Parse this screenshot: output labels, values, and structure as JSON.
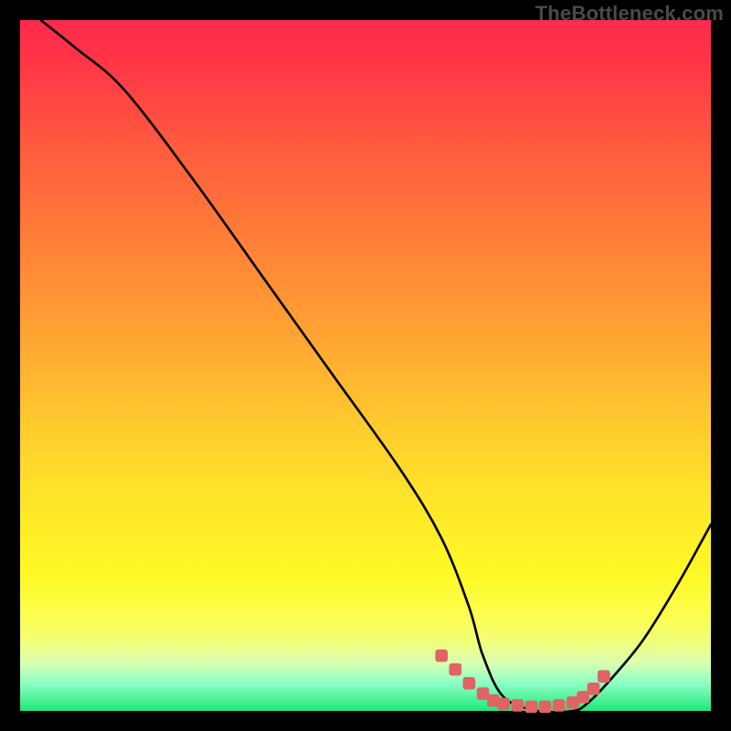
{
  "watermark": "TheBottleneck.com",
  "chart_data": {
    "type": "line",
    "title": "",
    "xlabel": "",
    "ylabel": "",
    "xlim": [
      0,
      100
    ],
    "ylim": [
      0,
      100
    ],
    "grid": false,
    "legend": false,
    "series": [
      {
        "name": "bottleneck-curve",
        "x": [
          3,
          8,
          15,
          25,
          35,
          45,
          55,
          61,
          65,
          67,
          70,
          75,
          80,
          82,
          85,
          90,
          95,
          100
        ],
        "y": [
          100,
          96,
          90,
          77,
          63,
          49,
          35,
          25,
          15,
          8,
          2,
          0,
          0,
          1,
          4,
          10,
          18,
          27
        ],
        "color": "#000000",
        "stroke_width": 2
      },
      {
        "name": "optimal-dots",
        "type": "scatter",
        "x": [
          61,
          63,
          65,
          67,
          68.5,
          70,
          72,
          74,
          76,
          78,
          80,
          81.5,
          83,
          84.5
        ],
        "y": [
          8,
          6,
          4,
          2.5,
          1.5,
          1,
          0.8,
          0.6,
          0.6,
          0.8,
          1.2,
          2,
          3.2,
          5
        ],
        "color": "#e06464",
        "marker_size": 6
      }
    ],
    "background_gradient": {
      "type": "vertical",
      "stops": [
        {
          "pos": 0.0,
          "color": "#ff2a4d"
        },
        {
          "pos": 0.3,
          "color": "#ff7a38"
        },
        {
          "pos": 0.6,
          "color": "#ffd22e"
        },
        {
          "pos": 0.85,
          "color": "#fdff4d"
        },
        {
          "pos": 1.0,
          "color": "#20e87a"
        }
      ]
    }
  }
}
